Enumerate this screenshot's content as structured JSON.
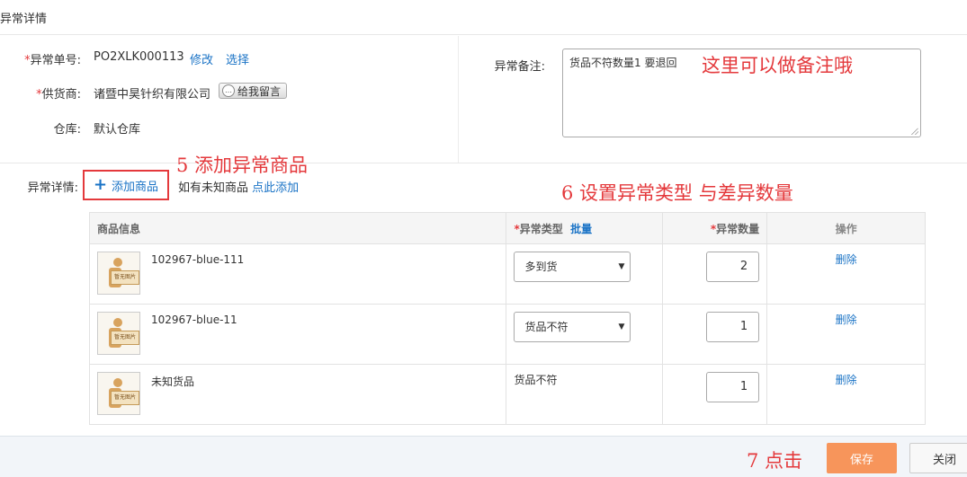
{
  "header": {
    "title": "异常详情"
  },
  "form": {
    "order_label": "异常单号:",
    "order_value": "PO2XLK000113",
    "edit_link": "修改",
    "select_link": "选择",
    "supplier_label": "供货商:",
    "supplier_value": "诸暨中昊针织有限公司",
    "message_button": "给我留言",
    "warehouse_label": "仓库:",
    "warehouse_value": "默认仓库",
    "remark_label": "异常备注:",
    "remark_value": "货品不符数量1 要退回"
  },
  "annotations": {
    "remark_note": "这里可以做备注哦",
    "step5": "5 添加异常商品",
    "step6": "6 设置异常类型 与差异数量",
    "step7": "7 点击"
  },
  "details": {
    "label": "异常详情:",
    "add_button": "添加商品",
    "unknown_text": "如有未知商品",
    "unknown_link": "点此添加"
  },
  "table": {
    "headers": {
      "info": "商品信息",
      "type": "异常类型",
      "batch": "批量",
      "qty": "异常数量",
      "ops": "操作"
    },
    "thumb_text": "暂无图片",
    "rows": [
      {
        "name": "102967-blue-111",
        "type": "多到货",
        "qty": "2",
        "action": "删除"
      },
      {
        "name": "102967-blue-11",
        "type": "货品不符",
        "qty": "1",
        "action": "删除"
      },
      {
        "name": "未知货品",
        "type": "货品不符",
        "qty": "1",
        "action": "删除"
      }
    ]
  },
  "footer": {
    "save": "保存",
    "close": "关闭"
  },
  "colors": {
    "accent_link": "#1a73c6",
    "required": "#e4393c",
    "save": "#f7955b",
    "annotation": "#e4393c"
  }
}
